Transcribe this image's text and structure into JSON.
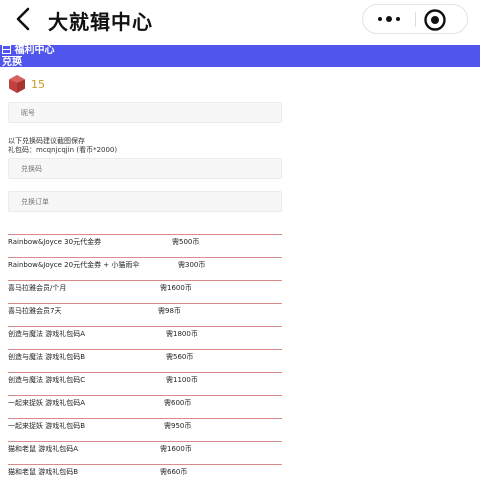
{
  "nav": {
    "title": "大就辑中心"
  },
  "banner": {
    "heading": "福利中心",
    "subheading": "兑换"
  },
  "points": {
    "value": "15"
  },
  "search": {
    "placeholder": "昵号"
  },
  "notice": {
    "line1": "以下兑换码建议截图保存",
    "line2": "礼包码：mcqnjcqjin (看币*2000)"
  },
  "inputs": {
    "redeem_placeholder": "兑换码",
    "order_placeholder": "兑换订单"
  },
  "items": [
    {
      "name": "Rainbow&Joyce 30元代金券",
      "cost": "需500币"
    },
    {
      "name": "Rainbow&Joyce 20元代金券 + 小猫雨伞",
      "cost": "需300币"
    },
    {
      "name": "喜马拉雅会员/个月",
      "cost": "需1600币"
    },
    {
      "name": "喜马拉雅会员7天",
      "cost": "需98币"
    },
    {
      "name": "创造与魔法 游戏礼包码A",
      "cost": "需1800币"
    },
    {
      "name": "创造与魔法 游戏礼包码B",
      "cost": "需560币"
    },
    {
      "name": "创造与魔法 游戏礼包码C",
      "cost": "需1100币"
    },
    {
      "name": "一起来捉妖 游戏礼包码A",
      "cost": "需600币"
    },
    {
      "name": "一起来捉妖 游戏礼包码B",
      "cost": "需950币"
    },
    {
      "name": "猫和老鼠 游戏礼包码A",
      "cost": "需1600币"
    },
    {
      "name": "猫和老鼠 游戏礼包码B",
      "cost": "需660币"
    }
  ],
  "colors": {
    "banner": "#5055ee",
    "divider": "#d98a8a",
    "points": "#c89a20",
    "gem": "#c2413e"
  }
}
